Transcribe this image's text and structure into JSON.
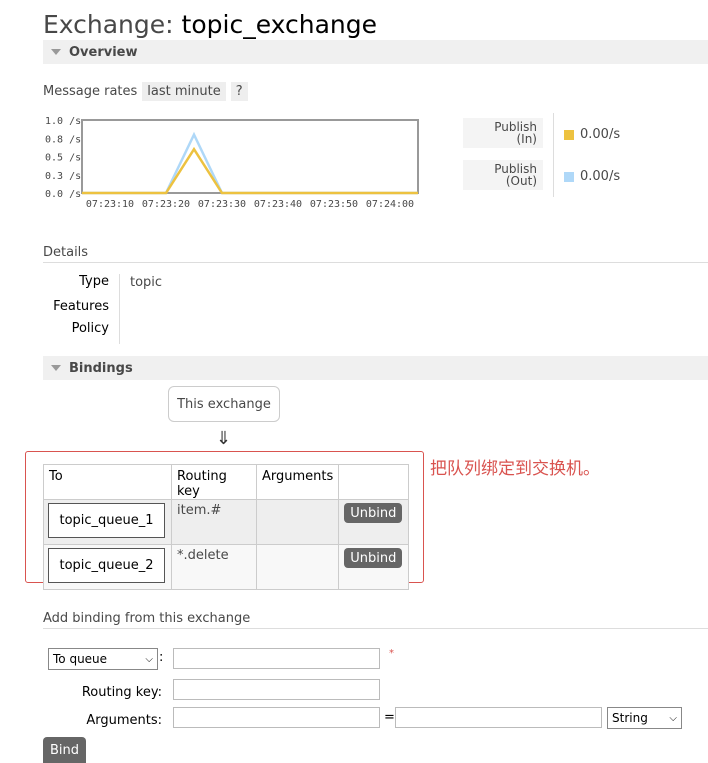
{
  "page": {
    "title_prefix": "Exchange:",
    "title_name": "topic_exchange"
  },
  "overview": {
    "section_label": "Overview",
    "message_rates_label": "Message rates",
    "range_label": "last minute",
    "help_label": "?",
    "legend": [
      {
        "label_line1": "Publish",
        "label_line2": "(In)",
        "value": "0.00/s",
        "color": "#edc240"
      },
      {
        "label_line1": "Publish",
        "label_line2": "(Out)",
        "value": "0.00/s",
        "color": "#afd8f8"
      }
    ]
  },
  "chart_data": {
    "type": "line",
    "x_ticks": [
      "07:23:10",
      "07:23:20",
      "07:23:30",
      "07:23:40",
      "07:23:50",
      "07:24:00"
    ],
    "y_ticks": [
      "1.0 /s",
      "0.8 /s",
      "0.5 /s",
      "0.3 /s",
      "0.0 /s"
    ],
    "ylim": [
      0,
      1.0
    ],
    "x_seconds": [
      5,
      15,
      20,
      25,
      30,
      60
    ],
    "series": [
      {
        "name": "Publish (In)",
        "color": "#edc240",
        "values": [
          0,
          0,
          0.6,
          0,
          0,
          0
        ]
      },
      {
        "name": "Publish (Out)",
        "color": "#afd8f8",
        "values": [
          0,
          0,
          0.8,
          0,
          0,
          0
        ]
      }
    ],
    "grid": false
  },
  "details": {
    "section_label": "Details",
    "type_key": "Type",
    "type_value": "topic",
    "features_key": "Features",
    "policy_key": "Policy"
  },
  "bindings": {
    "section_label": "Bindings",
    "this_exchange_label": "This exchange",
    "arrow": "⇓",
    "note": "把队列绑定到交换机。",
    "headers": [
      "To",
      "Routing key",
      "Arguments",
      ""
    ],
    "rows": [
      {
        "queue": "topic_queue_1",
        "routing_key": "item.#",
        "arguments": "",
        "action": "Unbind"
      },
      {
        "queue": "topic_queue_2",
        "routing_key": "*.delete",
        "arguments": "",
        "action": "Unbind"
      }
    ]
  },
  "add_binding": {
    "section_label": "Add binding from this exchange",
    "destination_type": "To queue",
    "required_mark": "*",
    "routing_key_label": "Routing key:",
    "arguments_label": "Arguments:",
    "equals": "=",
    "arg_type": "String",
    "bind_label": "Bind"
  },
  "colors": {
    "accent_red": "#d9534f",
    "button_gray": "#666666"
  }
}
